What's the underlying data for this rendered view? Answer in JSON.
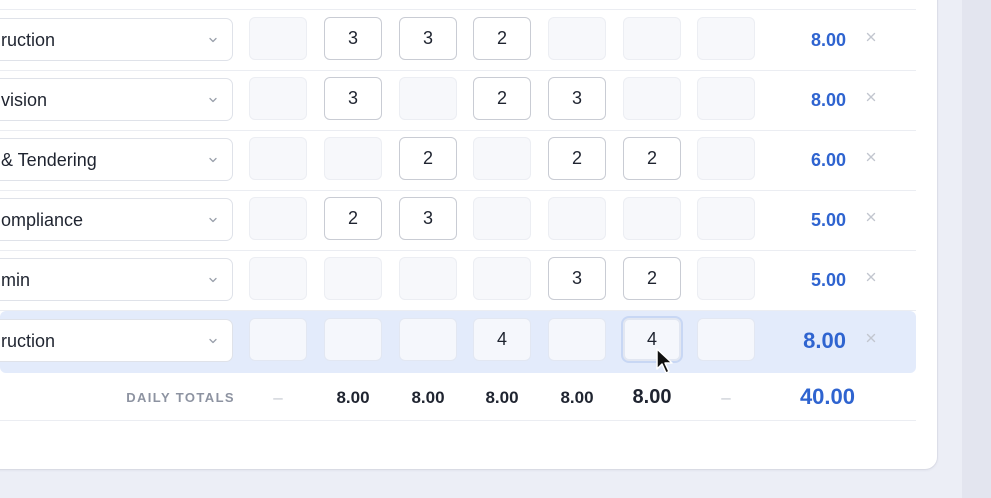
{
  "rows": [
    {
      "project": "ruction",
      "days": [
        "",
        "3",
        "3",
        "2",
        "",
        "",
        ""
      ],
      "total": "8.00"
    },
    {
      "project": "vision",
      "days": [
        "",
        "3",
        "",
        "2",
        "3",
        "",
        ""
      ],
      "total": "8.00"
    },
    {
      "project": "& Tendering",
      "days": [
        "",
        "",
        "2",
        "",
        "2",
        "2",
        ""
      ],
      "total": "6.00"
    },
    {
      "project": "ompliance",
      "days": [
        "",
        "2",
        "3",
        "",
        "",
        "",
        ""
      ],
      "total": "5.00"
    },
    {
      "project": "min",
      "days": [
        "",
        "",
        "",
        "",
        "3",
        "2",
        ""
      ],
      "total": "5.00"
    },
    {
      "project": "ruction",
      "days": [
        "",
        "",
        "",
        "4",
        "",
        "4",
        ""
      ],
      "total": "8.00",
      "selected": true,
      "focused_day": 5
    }
  ],
  "totals": {
    "label": "DAILY TOTALS",
    "days": [
      "–",
      "8.00",
      "8.00",
      "8.00",
      "8.00",
      "8.00",
      "–"
    ],
    "grand": "40.00"
  },
  "icons": {
    "dropdown": "chevron-down-icon",
    "remove": "close-icon",
    "cursor": "mouse-pointer-icon"
  },
  "colors": {
    "accent": "#2f64d0",
    "selected_row": "#e3ebfb",
    "focus_border": "#3264d2"
  }
}
